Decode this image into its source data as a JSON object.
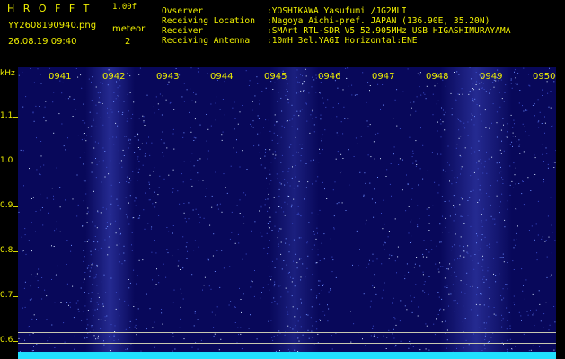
{
  "header": {
    "app_name": "HROFFT",
    "version": "1.00f",
    "filename": "YY2608190940.png",
    "datetime": "26.08.19 09:40",
    "meteor_label": "meteor",
    "meteor_count": "2",
    "info": [
      {
        "label": "Ovserver",
        "value": ":YOSHIKAWA Yasufumi /JG2MLI"
      },
      {
        "label": "Receiving Location",
        "value": ":Nagoya Aichi-pref. JAPAN (136.90E, 35.20N)"
      },
      {
        "label": "Receiver",
        "value": ":SMArt RTL-SDR V5 52.905MHz USB HIGASHIMURAYAMA"
      },
      {
        "label": "Receiving Antenna",
        "value": ":10mH 3el.YAGI Horizontal:ENE"
      }
    ]
  },
  "spectrogram": {
    "y_unit": "kHz",
    "y_ticks": [
      "1.1",
      "1.0",
      "0.9",
      "0.8",
      "0.7",
      "0.6"
    ],
    "time_labels": [
      "0941",
      "0942",
      "0943",
      "0944",
      "0945",
      "0946",
      "0947",
      "0948",
      "0949",
      "0950"
    ],
    "colors": {
      "background": "#08085a",
      "text": "#f0f000",
      "noise": "#20e0ff"
    }
  }
}
